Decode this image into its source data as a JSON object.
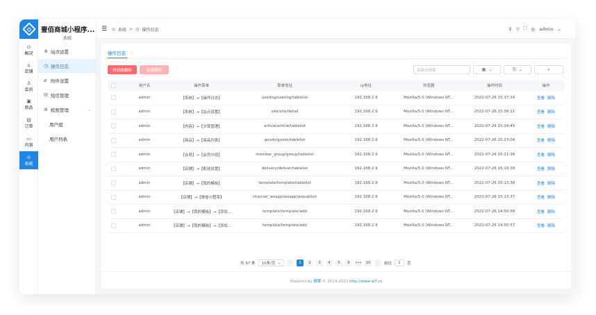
{
  "app": {
    "title": "壹佰商城小程序...",
    "subtitle": "系统"
  },
  "rail": [
    {
      "label": "概况",
      "icon": "home-icon",
      "glyph": "⊙"
    },
    {
      "label": "店铺",
      "icon": "shop-icon",
      "glyph": "⌂"
    },
    {
      "label": "会员",
      "icon": "user-icon",
      "glyph": "♙"
    },
    {
      "label": "商品",
      "icon": "box-icon",
      "glyph": "▣"
    },
    {
      "label": "订单",
      "icon": "order-icon",
      "glyph": "▤"
    },
    {
      "label": "内容",
      "icon": "folder-icon",
      "glyph": "▭"
    },
    {
      "label": "系统",
      "icon": "system-icon",
      "glyph": "⊙"
    }
  ],
  "submenu": [
    {
      "label": "站点设置",
      "icon": "sitemap-icon",
      "glyph": "⋔"
    },
    {
      "label": "操作日志",
      "icon": "clock-icon",
      "glyph": "◷"
    },
    {
      "label": "附件设置",
      "icon": "attachment-icon",
      "glyph": "⌀"
    },
    {
      "label": "短信管理",
      "icon": "mail-icon",
      "glyph": "✉"
    },
    {
      "label": "权限管理",
      "icon": "lock-icon",
      "glyph": "⊚"
    }
  ],
  "submenu_children": [
    "用户组",
    "用户列表"
  ],
  "breadcrumb": {
    "root": "系统",
    "sep": ">",
    "current": "操作日志"
  },
  "header": {
    "user": "admin"
  },
  "tab": "操作日志",
  "toolbar": {
    "time_delete": "时间段删除",
    "batch_delete": "批量删除",
    "search_placeholder": "关键词搜索"
  },
  "table": {
    "columns": [
      "用户名",
      "操作菜单",
      "菜单地址",
      "ip地址",
      "浏览器",
      "操作时间",
      "操作"
    ],
    "actions": [
      "查看",
      "删除"
    ],
    "rows": [
      [
        "admin",
        "【系统】→【操作日志】",
        "userlog/userlog/tablelist",
        "192.168.2.9",
        "Mozilla/5.0 (Windows NT...",
        "2022-07-26 15:37:34"
      ],
      [
        "admin",
        "【系统】→【站点设置】",
        "site/site/detail",
        "192.168.2.9",
        "Mozilla/5.0 (Windows NT...",
        "2022-07-26 15:36:11"
      ],
      [
        "admin",
        "【内容】→【文章管理】",
        "article/article/tablelist",
        "192.168.2.9",
        "Mozilla/5.0 (Windows NT...",
        "2022-07-26 15:34:45"
      ],
      [
        "admin",
        "【商品】→【商品列表】",
        "goods/goods/tablelist",
        "192.168.2.9",
        "Mozilla/5.0 (Windows NT...",
        "2022-07-26 15:23:04"
      ],
      [
        "admin",
        "【会员】→【会员分组】",
        "member_group/group/tablelist",
        "192.168.2.9",
        "Mozilla/5.0 (Windows NT...",
        "2022-07-26 15:21:36"
      ],
      [
        "admin",
        "【店铺】→【配送设置】",
        "delivery/deliver/tablelist",
        "192.168.2.9",
        "Mozilla/5.0 (Windows NT...",
        "2022-07-26 15:19:39"
      ],
      [
        "admin",
        "【店铺】→【我的模板】",
        "template/template/tablelist",
        "192.168.2.9",
        "Mozilla/5.0 (Windows NT...",
        "2022-07-26 15:13:38"
      ],
      [
        "admin",
        "【店铺】→【微信小程序】",
        "channel_wxapp/wxapp/wxpublish",
        "192.168.2.9",
        "Mozilla/5.0 (Windows NT...",
        "2022-07-26 15:13:37"
      ],
      [
        "admin",
        "【店铺】→【我的模板】→【添加...",
        "template/template/add",
        "192.168.2.9",
        "Mozilla/5.0 (Windows NT...",
        "2022-07-26 14:50:58"
      ],
      [
        "admin",
        "【店铺】→【我的模板】→【添加...",
        "template/template/add",
        "192.168.2.9",
        "Mozilla/5.0 (Windows NT...",
        "2022-07-26 14:50:57"
      ]
    ]
  },
  "pagination": {
    "total": "共 97 条",
    "page_size": "10条/页",
    "pages": [
      "1",
      "2",
      "3",
      "4",
      "5",
      "6",
      "•••",
      "10"
    ],
    "current": "1",
    "prev": "‹",
    "next": "›",
    "goto_label": "前往",
    "goto_value": "1",
    "page_unit": "页"
  },
  "footer": {
    "prefix": "Powered by ",
    "brand": "微擎",
    "suffix": " © 2014-2021 ",
    "link": "http://www.w7.cc"
  },
  "colors": {
    "accent": "#1f86e5",
    "danger": "#f56c6c"
  }
}
